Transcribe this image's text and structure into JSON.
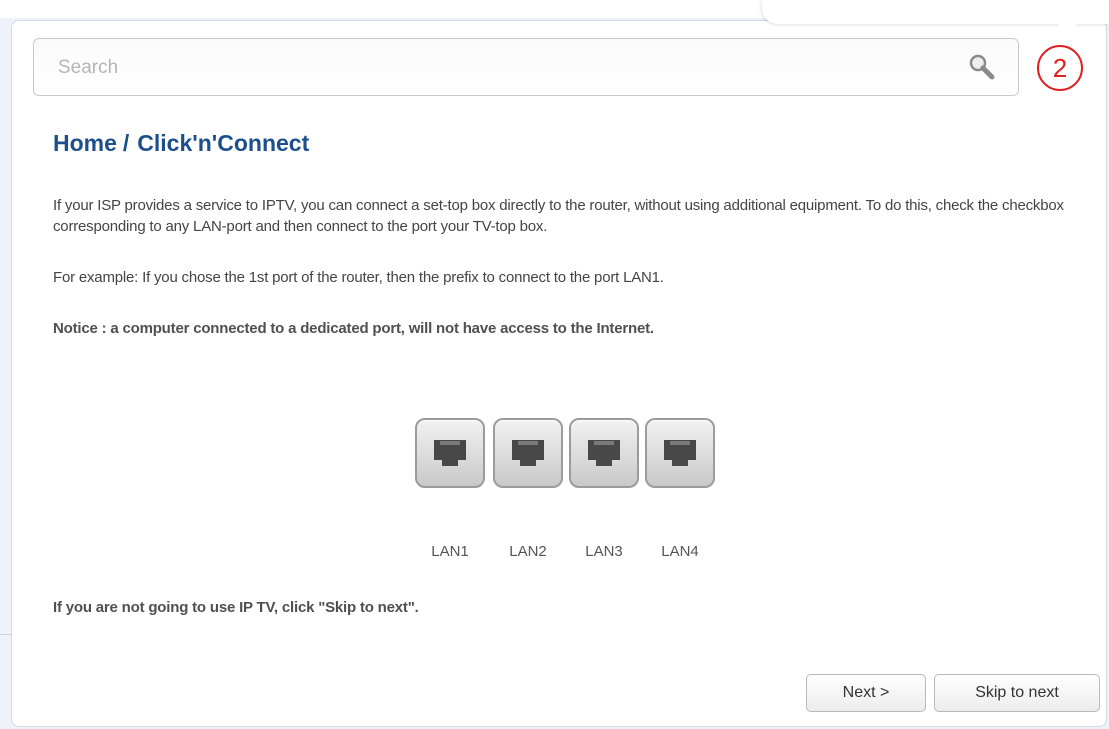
{
  "search": {
    "placeholder": "Search"
  },
  "step": {
    "number": "2",
    "color": "#e02020"
  },
  "breadcrumb": {
    "home": "Home",
    "separator": "/",
    "current": "Click'n'Connect"
  },
  "content": {
    "paragraph1": "If your ISP provides a service to IPTV, you can connect a set-top box directly to the router, without using additional equipment. To do this, check the checkbox corresponding to any LAN-port and then connect to the port your TV-top box.",
    "paragraph2": "For example: If you chose the 1st port of the router, then the prefix to connect to the port LAN1.",
    "notice": "Notice : a computer connected to a dedicated port, will not have access to the Internet.",
    "skip_hint": "If you are not going to use IP TV, click \"Skip to next\"."
  },
  "ports": [
    {
      "label": "LAN1",
      "icon": "ethernet-port-icon"
    },
    {
      "label": "LAN2",
      "icon": "ethernet-port-icon"
    },
    {
      "label": "LAN3",
      "icon": "ethernet-port-icon"
    },
    {
      "label": "LAN4",
      "icon": "ethernet-port-icon"
    }
  ],
  "buttons": {
    "next": "Next >",
    "skip": "Skip to next"
  },
  "colors": {
    "title": "#1d4f8c",
    "accent_badge": "#e02020",
    "background_panel": "#edf3f9"
  }
}
